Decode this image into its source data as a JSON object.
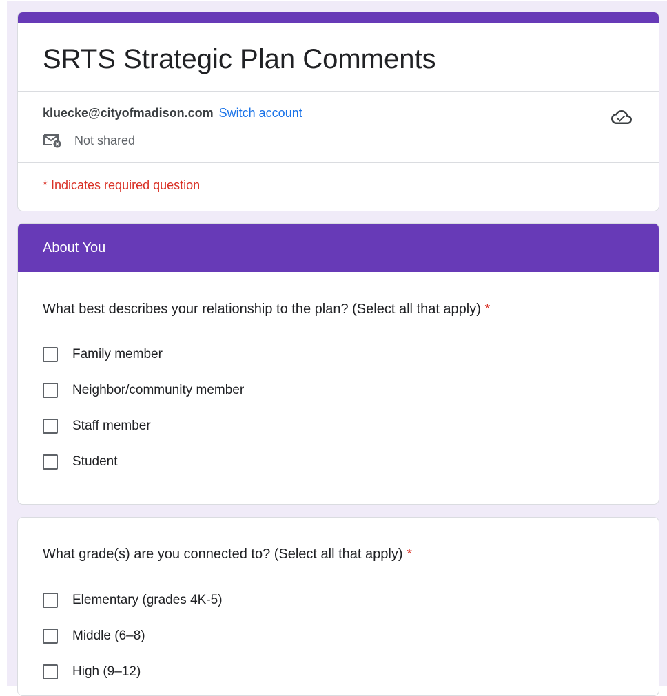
{
  "form": {
    "title": "SRTS Strategic Plan Comments",
    "account_email": "kluecke@cityofmadison.com",
    "switch_account_label": "Switch account",
    "sharing_status": "Not shared",
    "required_note": "* Indicates required question"
  },
  "section": {
    "title": "About You"
  },
  "questions": [
    {
      "text": "What best describes your relationship to the plan? (Select all that apply)",
      "required_marker": "*",
      "options": [
        {
          "label": "Family member",
          "checked": false
        },
        {
          "label": "Neighbor/community member",
          "checked": false
        },
        {
          "label": "Staff member",
          "checked": false
        },
        {
          "label": "Student",
          "checked": false
        }
      ]
    },
    {
      "text": "What grade(s) are you connected to? (Select all that apply)",
      "required_marker": "*",
      "options": [
        {
          "label": "Elementary (grades 4K-5)",
          "checked": false
        },
        {
          "label": "Middle (6–8)",
          "checked": false
        },
        {
          "label": "High (9–12)",
          "checked": false
        }
      ]
    }
  ],
  "colors": {
    "accent": "#673ab7",
    "background": "#f0ebf8",
    "required": "#d93025",
    "link": "#1a73e8"
  },
  "icons": {
    "cloud": "cloud-saved-icon",
    "mail": "mail-not-shared-icon"
  }
}
